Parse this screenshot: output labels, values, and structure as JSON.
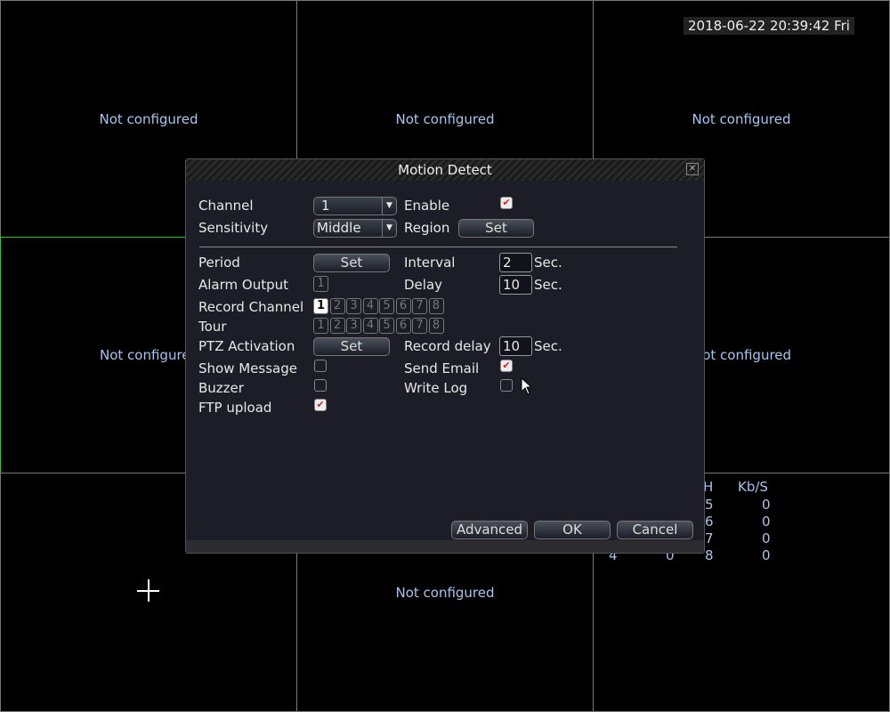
{
  "timestamp": "2018-06-22 20:39:42 Fri",
  "cells": [
    "Not configured",
    "Not configured",
    "Not configured",
    "Not configured",
    "Not configured",
    "Not configured",
    "Not configured"
  ],
  "status": {
    "h": "H",
    "kbs": "Kb/S",
    "rows": [
      [
        "5",
        "0"
      ],
      [
        "6",
        "0"
      ],
      [
        "7",
        "0"
      ],
      [
        "4",
        "0",
        "8",
        "0"
      ]
    ]
  },
  "dialog": {
    "title": "Motion Detect",
    "channel": {
      "label": "Channel",
      "value": "1"
    },
    "enable": {
      "label": "Enable",
      "checked": true
    },
    "sensitivity": {
      "label": "Sensitivity",
      "value": "Middle"
    },
    "region": {
      "label": "Region",
      "button": "Set"
    },
    "period": {
      "label": "Period",
      "button": "Set"
    },
    "interval": {
      "label": "Interval",
      "value": "2",
      "unit": "Sec."
    },
    "alarm_output": {
      "label": "Alarm Output",
      "channels": [
        "1"
      ]
    },
    "delay": {
      "label": "Delay",
      "value": "10",
      "unit": "Sec."
    },
    "record_channel": {
      "label": "Record Channel",
      "channels": [
        "1",
        "2",
        "3",
        "4",
        "5",
        "6",
        "7",
        "8"
      ],
      "selected": [
        "1"
      ]
    },
    "tour": {
      "label": "Tour",
      "channels": [
        "1",
        "2",
        "3",
        "4",
        "5",
        "6",
        "7",
        "8"
      ]
    },
    "ptz": {
      "label": "PTZ Activation",
      "button": "Set"
    },
    "record_delay": {
      "label": "Record delay",
      "value": "10",
      "unit": "Sec."
    },
    "show_message": {
      "label": "Show Message",
      "checked": false
    },
    "send_email": {
      "label": "Send Email",
      "checked": true
    },
    "buzzer": {
      "label": "Buzzer",
      "checked": false
    },
    "write_log": {
      "label": "Write Log",
      "checked": false
    },
    "ftp": {
      "label": "FTP upload",
      "checked": true
    },
    "buttons": {
      "advanced": "Advanced",
      "ok": "OK",
      "cancel": "Cancel"
    }
  }
}
